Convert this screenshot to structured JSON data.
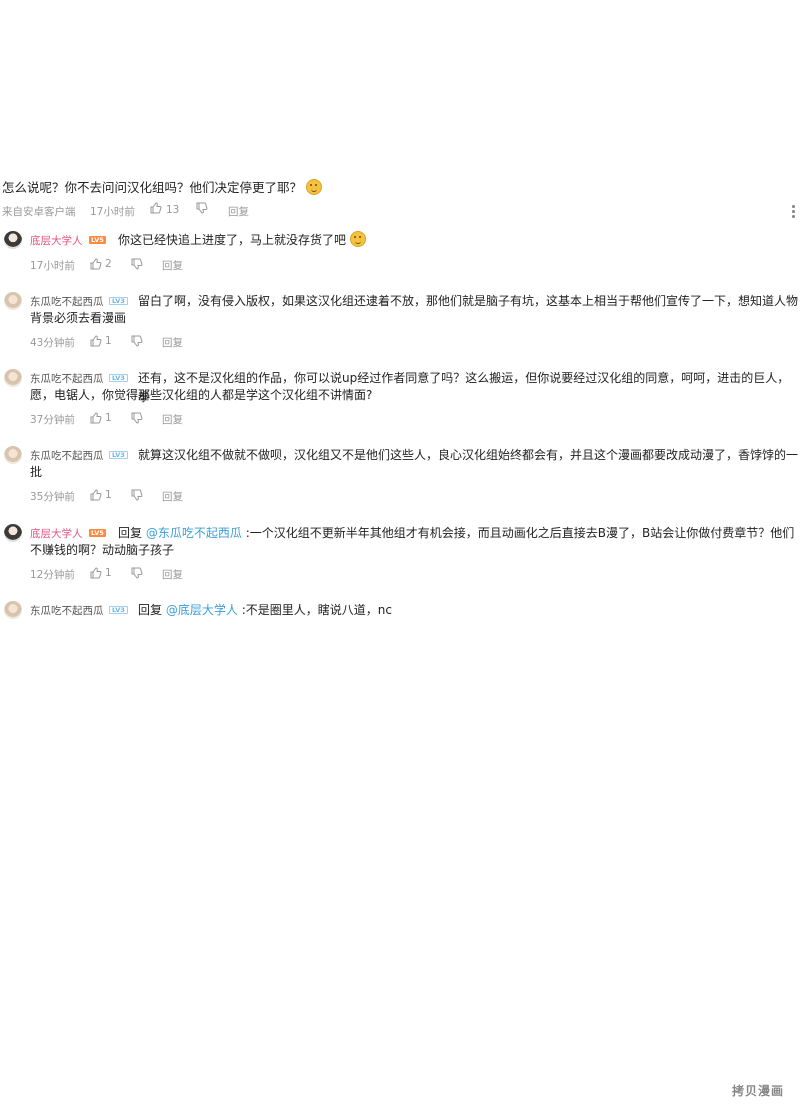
{
  "root": {
    "text": "怎么说呢？你不去问问汉化组吗？他们决定停更了耶？",
    "source": "来自安卓客户端",
    "time": "17小时前",
    "likes": "13",
    "reply_label": "回复"
  },
  "replies": [
    {
      "user": "底层大学人",
      "level": "LV5",
      "prefix": "",
      "mention": "",
      "text": "你这已经快追上进度了，马上就没存货了吧",
      "line2": "",
      "time": "17小时前",
      "likes": "2",
      "reply_label": "回复"
    },
    {
      "user": "东瓜吃不起西瓜",
      "level": "LV3",
      "prefix": "",
      "mention": "",
      "text": "留白了啊，没有侵入版权，如果这汉化组还逮着不放，那他们就是脑子有坑，这基本上相当于帮他们宣传了一下，想知道人物",
      "line2": "背景必须去看漫画",
      "time": "43分钟前",
      "likes": "1",
      "reply_label": "回复"
    },
    {
      "user": "东瓜吃不起西瓜",
      "level": "LV3",
      "prefix": "",
      "mention": "",
      "text": "还有，这不是汉化组的作品，你可以说up经过作者同意了吗？这么搬运，但你说要经过汉化组的同意，呵呵，进击的巨人，拳",
      "line2": "愿，电锯人，你觉得那些汉化组的人都是学这个汉化组不讲情面?",
      "time": "37分钟前",
      "likes": "1",
      "reply_label": "回复"
    },
    {
      "user": "东瓜吃不起西瓜",
      "level": "LV3",
      "prefix": "",
      "mention": "",
      "text": "就算这汉化组不做就不做呗，汉化组又不是他们这些人，良心汉化组始终都会有，并且这个漫画都要改成动漫了，香饽饽的一",
      "line2": "批",
      "time": "35分钟前",
      "likes": "1",
      "reply_label": "回复"
    },
    {
      "user": "底层大学人",
      "level": "LV5",
      "prefix": "回复",
      "mention": "@东瓜吃不起西瓜",
      "text": ":一个汉化组不更新半年其他组才有机会接，而且动画化之后直接去B漫了，B站会让你做付费章节？他们",
      "line2": "不赚钱的啊？动动脑子孩子",
      "time": "12分钟前",
      "likes": "1",
      "reply_label": "回复"
    },
    {
      "user": "东瓜吃不起西瓜",
      "level": "LV3",
      "prefix": "回复",
      "mention": "@底层大学人",
      "text": ":不是圈里人，瞎说八道，nc",
      "line2": "",
      "time": "",
      "likes": "",
      "reply_label": ""
    }
  ],
  "watermark": "拷贝漫画",
  "colors": {
    "pink_name": "#e8537f",
    "mention": "#3b9fd9",
    "level5": "#ff8a3d",
    "level3": "#6ab7e8",
    "meta": "#999999"
  },
  "icons": [
    "thumb-up-icon",
    "thumb-down-icon",
    "more-vertical-icon",
    "emoji-icon",
    "avatar"
  ]
}
